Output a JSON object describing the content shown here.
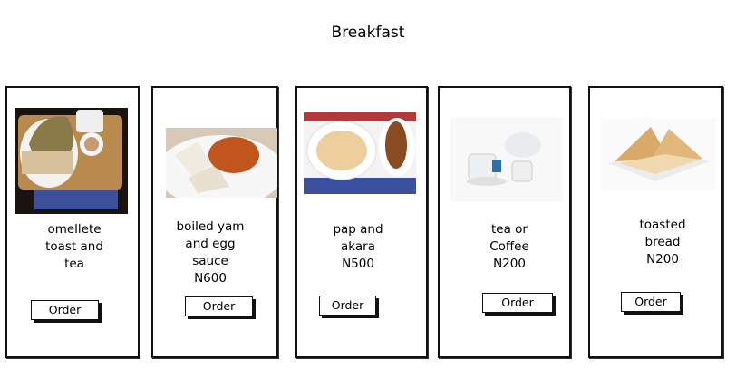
{
  "page": {
    "title": "Breakfast"
  },
  "items": [
    {
      "lines": [
        "omellete",
        "toast and",
        "tea"
      ],
      "order_label": "Order",
      "image": "omelette-toast-tea-photo"
    },
    {
      "lines": [
        "boiled yam",
        "and egg",
        "sauce",
        "N600"
      ],
      "order_label": "Order",
      "image": "boiled-yam-egg-sauce-photo"
    },
    {
      "lines": [
        "pap and",
        "akara",
        "N500"
      ],
      "order_label": "Order",
      "image": "pap-akara-photo"
    },
    {
      "lines": [
        "tea or",
        "Coffee",
        "N200"
      ],
      "order_label": "Order",
      "image": "tea-coffee-photo"
    },
    {
      "lines": [
        "toasted",
        "bread",
        "N200"
      ],
      "order_label": "Order",
      "image": "toasted-bread-photo"
    }
  ]
}
